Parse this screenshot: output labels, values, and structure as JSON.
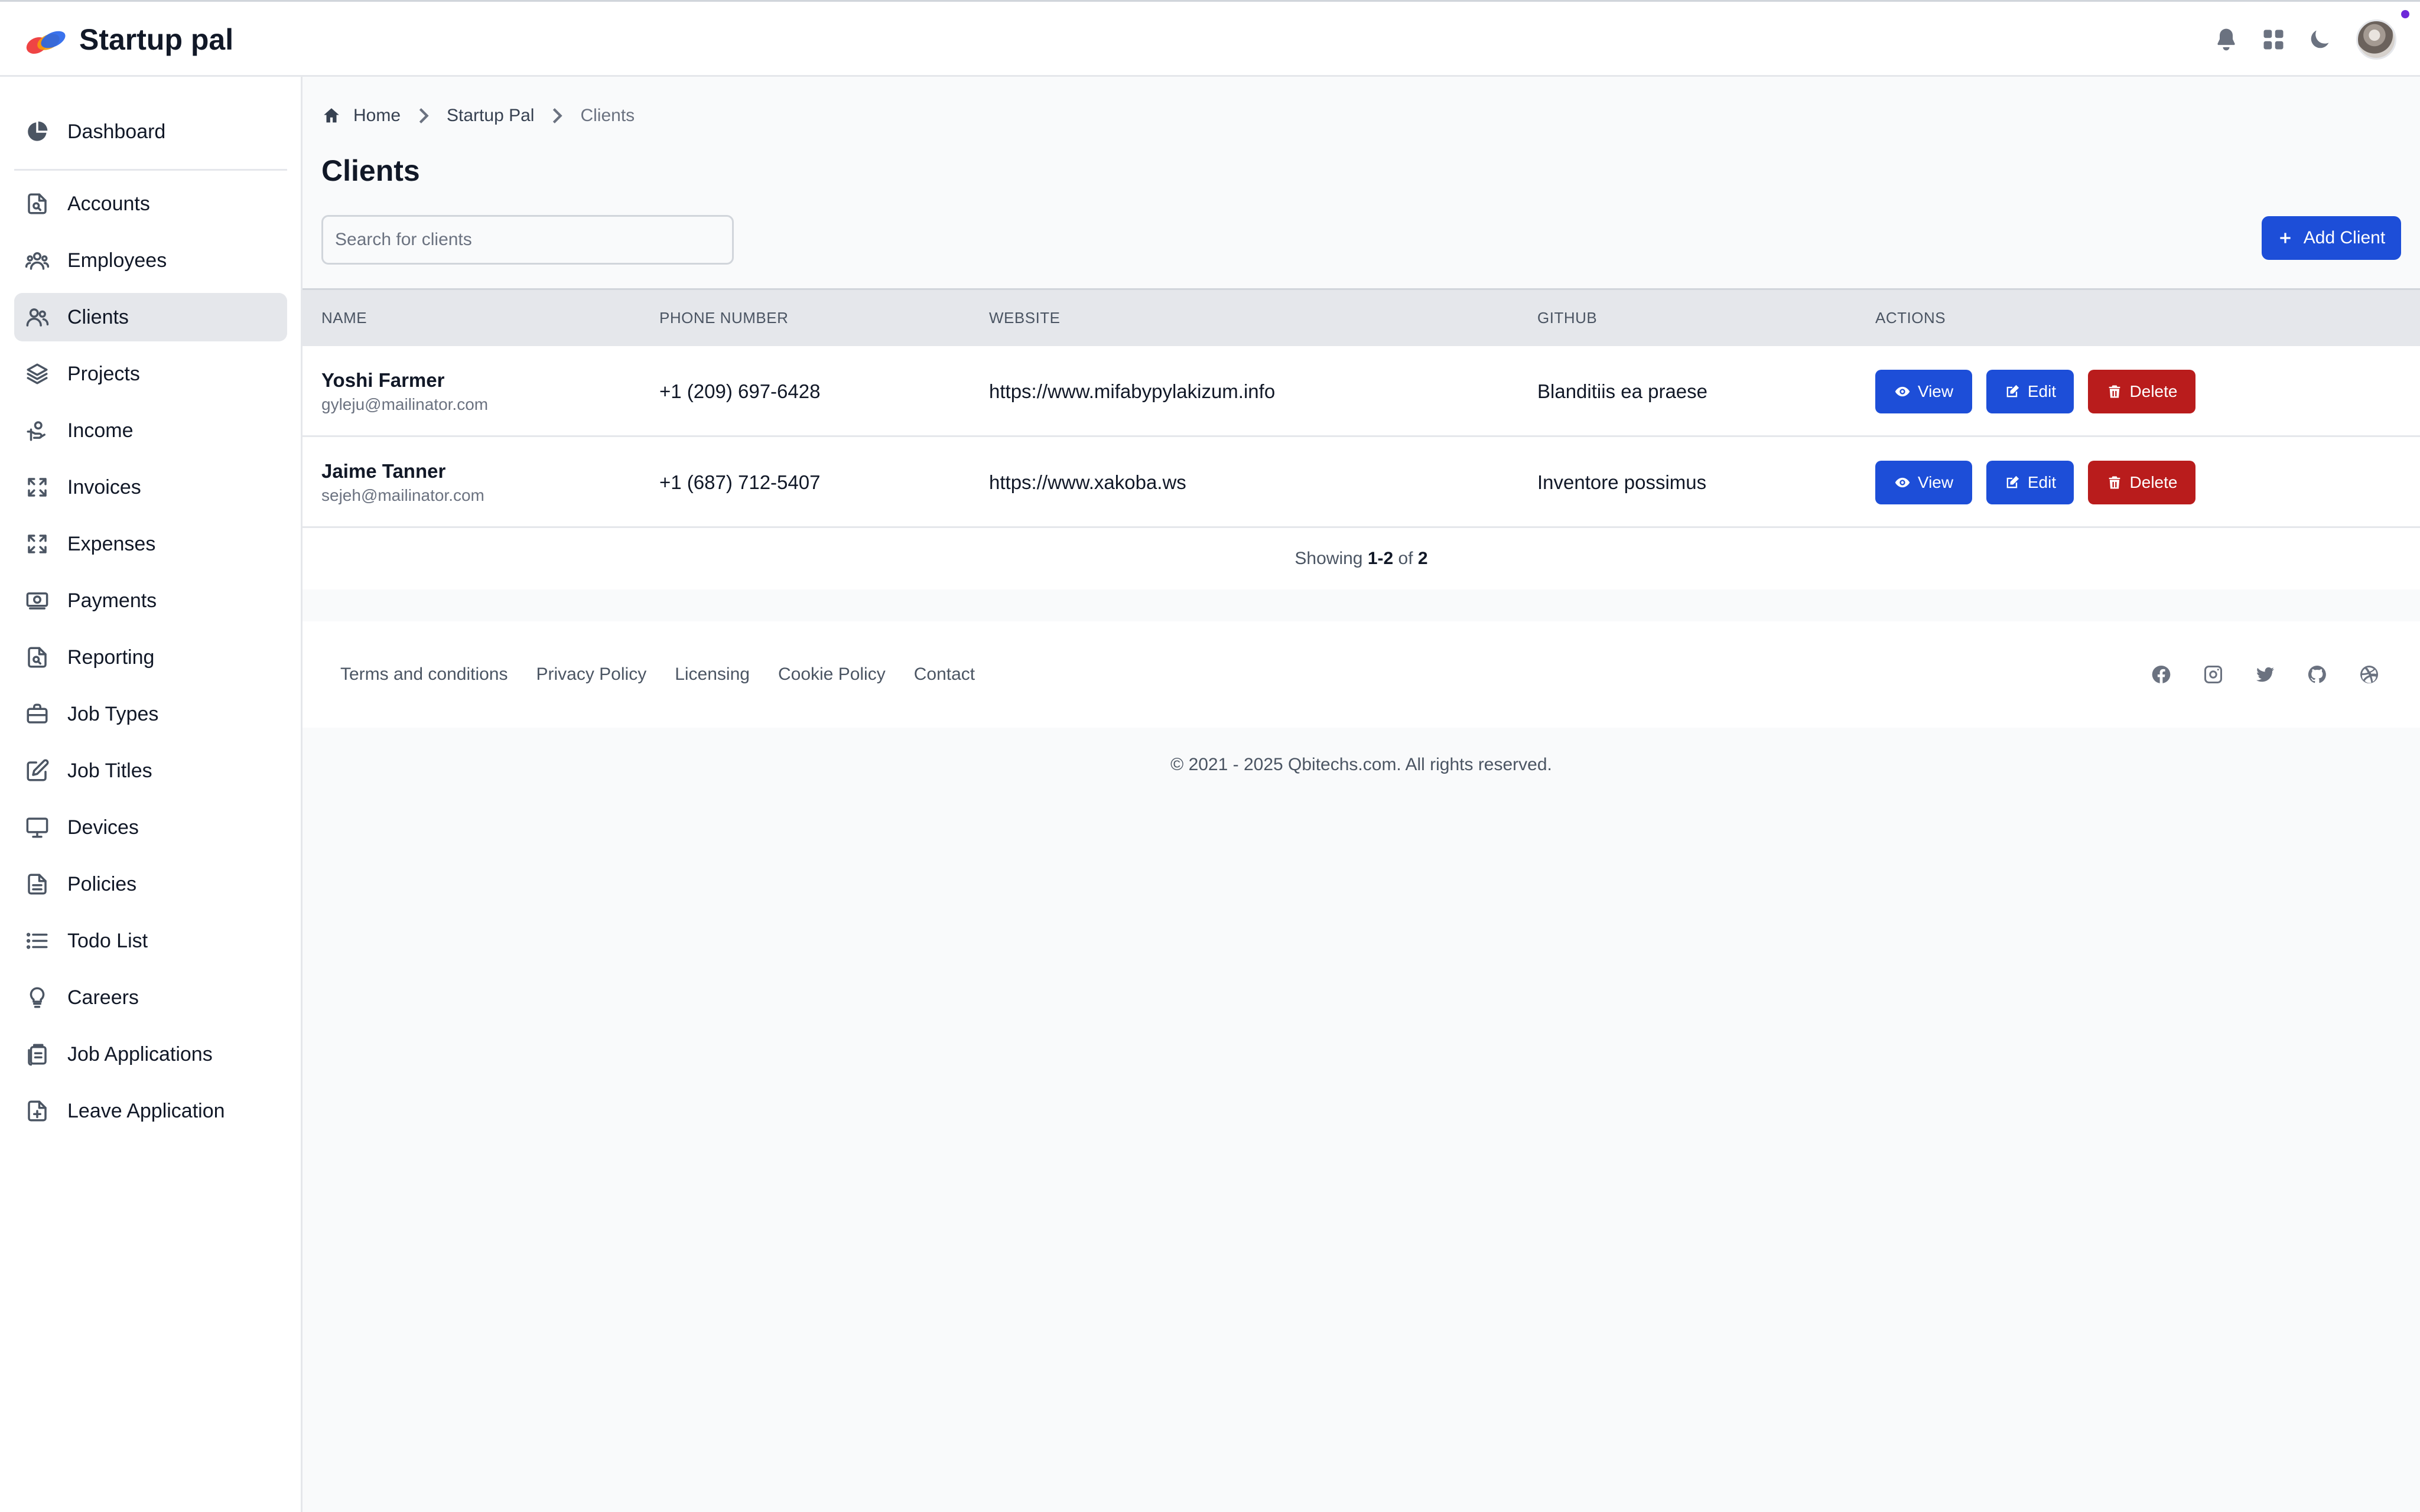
{
  "app": {
    "name": "Startup pal"
  },
  "sidebar": {
    "items": [
      {
        "label": "Dashboard",
        "icon": "chart-pie-icon",
        "active": false
      },
      {
        "label": "Accounts",
        "icon": "document-search-icon",
        "active": false
      },
      {
        "label": "Employees",
        "icon": "user-group-icon",
        "active": false
      },
      {
        "label": "Clients",
        "icon": "users-icon",
        "active": true
      },
      {
        "label": "Projects",
        "icon": "layers-icon",
        "active": false
      },
      {
        "label": "Income",
        "icon": "hand-coin-icon",
        "active": false
      },
      {
        "label": "Invoices",
        "icon": "expand-icon",
        "active": false
      },
      {
        "label": "Expenses",
        "icon": "expand-icon",
        "active": false
      },
      {
        "label": "Payments",
        "icon": "cash-icon",
        "active": false
      },
      {
        "label": "Reporting",
        "icon": "document-search-icon",
        "active": false
      },
      {
        "label": "Job Types",
        "icon": "briefcase-icon",
        "active": false
      },
      {
        "label": "Job Titles",
        "icon": "pencil-square-icon",
        "active": false
      },
      {
        "label": "Devices",
        "icon": "desktop-icon",
        "active": false
      },
      {
        "label": "Policies",
        "icon": "document-text-icon",
        "active": false
      },
      {
        "label": "Todo List",
        "icon": "list-icon",
        "active": false
      },
      {
        "label": "Careers",
        "icon": "lightbulb-icon",
        "active": false
      },
      {
        "label": "Job Applications",
        "icon": "clipboard-icon",
        "active": false
      },
      {
        "label": "Leave Application",
        "icon": "document-add-icon",
        "active": false
      }
    ]
  },
  "breadcrumb": {
    "home": "Home",
    "parent": "Startup Pal",
    "current": "Clients"
  },
  "page": {
    "title": "Clients"
  },
  "search": {
    "placeholder": "Search for clients",
    "value": ""
  },
  "add_button": {
    "label": "Add Client"
  },
  "table": {
    "headers": {
      "name": "Name",
      "phone": "Phone Number",
      "website": "Website",
      "github": "Github",
      "actions": "Actions"
    },
    "rows": [
      {
        "name": "Yoshi Farmer",
        "email": "gyleju@mailinator.com",
        "phone": "+1 (209) 697-6428",
        "website": "https://www.mifabypylakizum.info",
        "github": "Blanditiis ea praese"
      },
      {
        "name": "Jaime Tanner",
        "email": "sejeh@mailinator.com",
        "phone": "+1 (687) 712-5407",
        "website": "https://www.xakoba.ws",
        "github": "Inventore possimus"
      }
    ],
    "actions": {
      "view": "View",
      "edit": "Edit",
      "delete": "Delete"
    },
    "pagination": {
      "prefix": "Showing",
      "range": "1-2",
      "of": "of",
      "total": "2"
    }
  },
  "footer": {
    "links": [
      "Terms and conditions",
      "Privacy Policy",
      "Licensing",
      "Cookie Policy",
      "Contact"
    ],
    "social": [
      "facebook-icon",
      "instagram-icon",
      "twitter-icon",
      "github-icon",
      "dribbble-icon"
    ],
    "copyright": "© 2021 - 2025 Qbitechs.com. All rights reserved."
  },
  "colors": {
    "primary": "#1d4ed8",
    "danger": "#b91c1c",
    "active_bg": "#e5e7eb"
  }
}
